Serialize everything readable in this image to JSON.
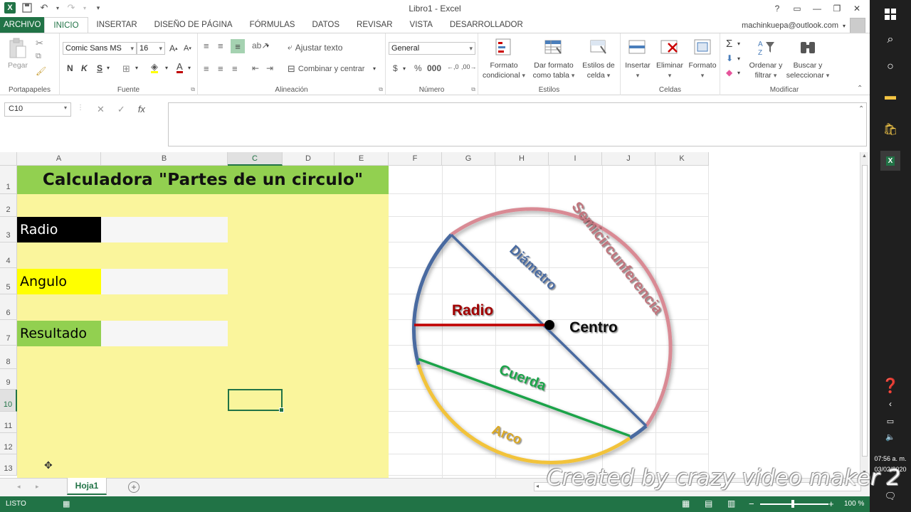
{
  "window": {
    "title": "Libro1 - Excel"
  },
  "tabs": [
    "ARCHIVO",
    "INICIO",
    "INSERTAR",
    "DISEÑO DE PÁGINA",
    "FÓRMULAS",
    "DATOS",
    "REVISAR",
    "VISTA",
    "DESARROLLADOR"
  ],
  "account": {
    "email": "machinkuepa@outlook.com"
  },
  "ribbon": {
    "clipboard": {
      "paste": "Pegar",
      "label": "Portapapeles"
    },
    "font": {
      "name": "Comic Sans MS",
      "size": "16",
      "bold": "N",
      "italic": "K",
      "underline": "S",
      "label": "Fuente"
    },
    "alignment": {
      "wrap": "Ajustar texto",
      "merge": "Combinar y centrar",
      "label": "Alineación"
    },
    "number": {
      "format": "General",
      "label": "Número"
    },
    "styles": {
      "cond1": "Formato",
      "cond2": "condicional",
      "table1": "Dar formato",
      "table2": "como tabla",
      "cell1": "Estilos de",
      "cell2": "celda",
      "label": "Estilos"
    },
    "cells": {
      "insert": "Insertar",
      "delete": "Eliminar",
      "format": "Formato",
      "label": "Celdas"
    },
    "editing": {
      "sort1": "Ordenar y",
      "sort2": "filtrar",
      "find1": "Buscar y",
      "find2": "seleccionar",
      "label": "Modificar"
    }
  },
  "formula_bar": {
    "name_box": "C10",
    "fx": "fx"
  },
  "columns": [
    "A",
    "B",
    "C",
    "D",
    "E",
    "F",
    "G",
    "H",
    "I",
    "J",
    "K"
  ],
  "rows": [
    "1",
    "2",
    "3",
    "4",
    "5",
    "6",
    "7",
    "8",
    "9",
    "10",
    "11",
    "12",
    "13"
  ],
  "sheet": {
    "title": "Calculadora \"Partes de un circulo\"",
    "labels": {
      "radio": "Radio",
      "angulo": "Angulo",
      "resultado": "Resultado"
    },
    "label_colors": {
      "radio": "#000000",
      "angulo": "#ffff00",
      "resultado": "#92d050"
    }
  },
  "diagram": {
    "semicircunferencia": "Semicircunferencia",
    "diametro": "Diámetro",
    "radio": "Radio",
    "centro": "Centro",
    "cuerda": "Cuerda",
    "arco": "Arco"
  },
  "sheet_tabs": [
    "Hoja1"
  ],
  "status": {
    "mode": "LISTO",
    "zoom": "100 %"
  },
  "taskbar": {
    "time": "07:56 a. m.",
    "date": "03/02/2020"
  },
  "watermark": "Created by crazy video maker 2"
}
